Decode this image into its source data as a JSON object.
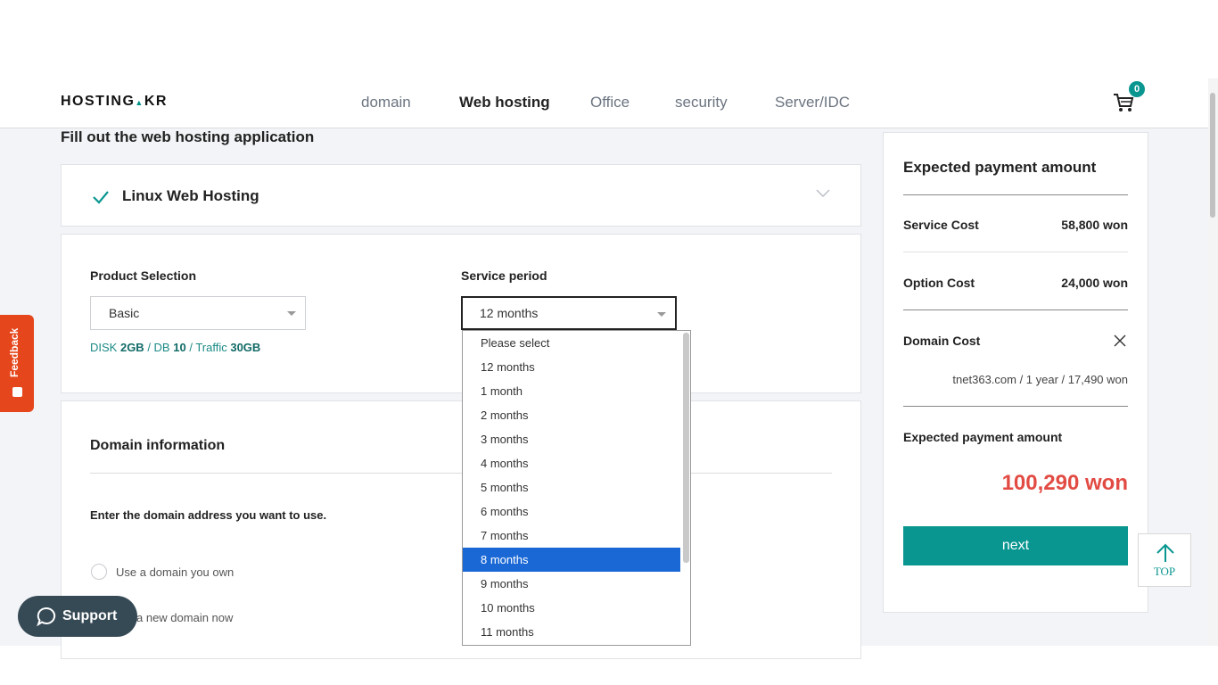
{
  "header": {
    "logo_text": "HOSTING",
    "logo_mark": "▲",
    "logo_suffix": "KR",
    "nav": [
      "domain",
      "Web hosting",
      "Office",
      "security",
      "Server/IDC"
    ],
    "cart_count": "0"
  },
  "page": {
    "title": "Fill out the web hosting application"
  },
  "accordion": {
    "title": "Linux Web Hosting"
  },
  "product": {
    "label": "Product Selection",
    "value": "Basic",
    "spec": {
      "disk_label": "DISK",
      "disk": "2GB",
      "db_label": "DB",
      "db": "10",
      "traffic_label": "Traffic",
      "traffic": "30GB"
    }
  },
  "period": {
    "label": "Service period",
    "value": "12 months",
    "options": [
      "Please select",
      "12 months",
      "1 month",
      "2 months",
      "3 months",
      "4 months",
      "5 months",
      "6 months",
      "7 months",
      "8 months",
      "9 months",
      "10 months",
      "11 months"
    ],
    "highlighted": "8 months"
  },
  "domain": {
    "section_title": "Domain information",
    "prompt": "Enter the domain address you want to use.",
    "opt_own": "Use a domain you own",
    "opt_new_tail": "a new domain now"
  },
  "summary": {
    "title": "Expected payment amount",
    "service_label": "Service Cost",
    "service_value": "58,800 won",
    "option_label": "Option Cost",
    "option_value": "24,000 won",
    "domain_label": "Domain Cost",
    "domain_detail": "tnet363.com / 1 year / 17,490 won",
    "total_label": "Expected payment amount",
    "total_value": "100,290 won",
    "next_label": "next"
  },
  "widgets": {
    "feedback": "Feedback",
    "support": "Support",
    "top": "TOP"
  },
  "colors": {
    "accent": "#0a9690",
    "total": "#e24b43",
    "highlight": "#1a68d6",
    "feedback": "#e5461b",
    "support": "#364a56"
  }
}
